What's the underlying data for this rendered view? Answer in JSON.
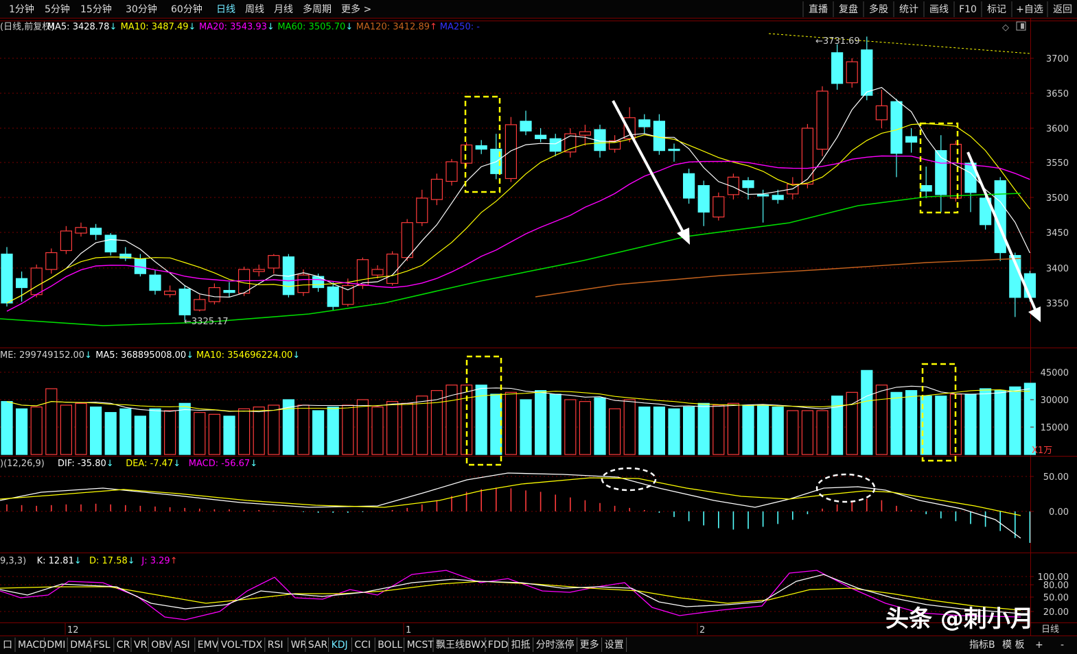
{
  "toolbar": {
    "periods": [
      "1分钟",
      "5分钟",
      "15分钟",
      "30分钟",
      "60分钟",
      "日线",
      "周线",
      "月线",
      "多周期",
      "更多 >"
    ],
    "active_period": "日线",
    "right_buttons": [
      "直播",
      "复盘",
      "多股",
      "统计",
      "画线",
      "F10",
      "标记",
      "+自选",
      "返回"
    ]
  },
  "colors": {
    "up": "#ff3b3b",
    "down": "#54ffff",
    "ma5": "#ffffff",
    "ma10": "#ffff00",
    "ma20": "#ff00ff",
    "ma60": "#00dd00",
    "ma120": "#c8641e",
    "ma250": "#3333ff",
    "grid": "#7a0000",
    "highlight_box": "#ffff00",
    "arrow": "#ffffff",
    "axis_text": "#d0d0d0"
  },
  "price_panel": {
    "header": [
      {
        "text": "(日线,前复权)",
        "color": "#d0d0d0",
        "arrow": ""
      },
      {
        "text": "MA5: 3428.78",
        "color": "#ffffff",
        "arrow": "↓"
      },
      {
        "text": "MA10: 3487.49",
        "color": "#ffff00",
        "arrow": "↓"
      },
      {
        "text": "MA20: 3543.93",
        "color": "#ff00ff",
        "arrow": "↓"
      },
      {
        "text": "MA60: 3505.70",
        "color": "#00dd00",
        "arrow": "↓"
      },
      {
        "text": "MA120: 3412.89",
        "color": "#c8641e",
        "arrow": "↑"
      },
      {
        "text": "MA250: -",
        "color": "#3333ff",
        "arrow": ""
      }
    ],
    "y_ticks": [
      "3700",
      "3650",
      "3600",
      "3550",
      "3500",
      "3450",
      "3400",
      "3350"
    ],
    "high_label": "3731.69",
    "low_label": "3325.17"
  },
  "volume_panel": {
    "header": [
      {
        "text": "ME: 299749152.00",
        "color": "#d0d0d0",
        "arrow": "↓"
      },
      {
        "text": "MA5: 368895008.00",
        "color": "#ffffff",
        "arrow": "↓"
      },
      {
        "text": "MA10: 354696224.00",
        "color": "#ffff00",
        "arrow": "↓"
      }
    ],
    "y_ticks": [
      "45000",
      "30000",
      "15000"
    ],
    "unit": "X1万"
  },
  "macd_panel": {
    "header": [
      {
        "text": ")(12,26,9)",
        "color": "#d0d0d0",
        "arrow": ""
      },
      {
        "text": "DIF: -35.80",
        "color": "#ffffff",
        "arrow": "↓"
      },
      {
        "text": "DEA: -7.47",
        "color": "#ffff00",
        "arrow": "↓"
      },
      {
        "text": "MACD: -56.67",
        "color": "#ff00ff",
        "arrow": "↓"
      }
    ],
    "y_ticks": [
      "50.00",
      "0.00"
    ]
  },
  "kdj_panel": {
    "header": [
      {
        "text": "9,3,3)",
        "color": "#d0d0d0",
        "arrow": ""
      },
      {
        "text": "K: 12.81",
        "color": "#ffffff",
        "arrow": "↓"
      },
      {
        "text": "D: 17.58",
        "color": "#ffff00",
        "arrow": "↓"
      },
      {
        "text": "J: 3.29",
        "color": "#ff00ff",
        "arrow": "↑"
      }
    ],
    "y_ticks": [
      "100.00",
      "80.00",
      "50.00",
      "20.00"
    ]
  },
  "x_axis_labels": [
    "12",
    "1",
    "2"
  ],
  "watermark": "头条 @刺小月",
  "corner_label": "日线",
  "bottom_tabs": [
    "口",
    "MACD",
    "DMI",
    "DMA",
    "FSL",
    "CR",
    "VR",
    "OBV",
    "ASI",
    "EMV",
    "VOL-TDX",
    "RSI",
    "WR",
    "SAR",
    "KDJ",
    "CCI",
    "BOLL",
    "MCST",
    "飘王线BWX",
    "FDD",
    "扣抵",
    "分时涨停",
    "更多",
    "设置"
  ],
  "active_bottom_tab": "KDJ",
  "bottom_right": [
    "指标B",
    "模 板",
    "+",
    "-"
  ]
}
